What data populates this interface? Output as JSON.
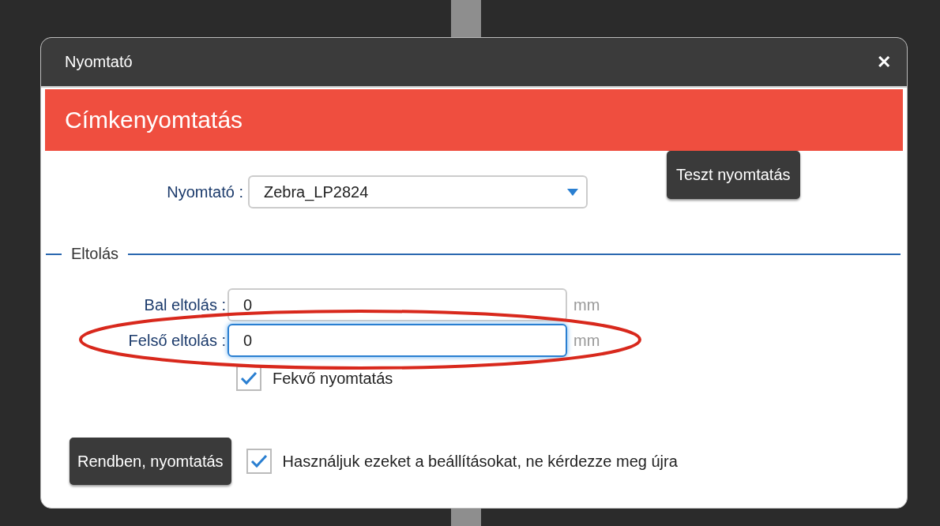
{
  "window": {
    "title": "Nyomtató",
    "close": "✕"
  },
  "banner": {
    "title": "Címkenyomtatás"
  },
  "test_button": "Teszt nyomtatás",
  "printer": {
    "label": "Nyomtató :",
    "value": "Zebra_LP2824"
  },
  "offset": {
    "legend": "Eltolás",
    "fields": [
      {
        "label": "Bal eltolás :",
        "value": "0",
        "unit": "mm",
        "focused": false
      },
      {
        "label": "Felső eltolás :",
        "value": "0",
        "unit": "mm",
        "focused": true
      }
    ],
    "landscape": {
      "label": "Fekvő nyomtatás",
      "checked": true
    }
  },
  "ok_button": "Rendben, nyomtatás",
  "remember": {
    "label": "Használjuk ezeket a beállításokat, ne kérdezze meg újra",
    "checked": true
  },
  "annotation": {
    "kind": "ellipse"
  }
}
